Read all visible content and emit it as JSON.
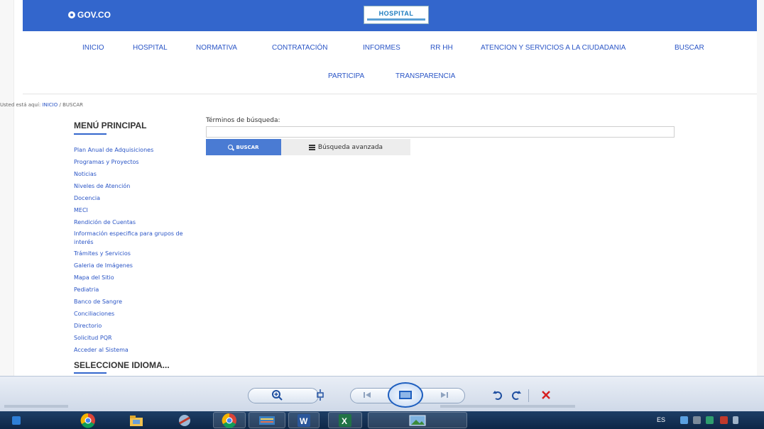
{
  "gov_bar": {
    "logo_text": "GOV.CO",
    "hospital_logo_text": "HOSPITAL"
  },
  "nav": {
    "row1": [
      "INICIO",
      "HOSPITAL",
      "NORMATIVA",
      "CONTRATACIÓN",
      "INFORMES",
      "RR HH",
      "ATENCION Y SERVICIOS A LA CIUDADANIA",
      "BUSCAR"
    ],
    "row2": [
      "PARTICIPA",
      "TRANSPARENCIA"
    ]
  },
  "breadcrumb": {
    "prefix": "Usted está aquí:",
    "home": "INICIO",
    "separator": "/",
    "current": "BUSCAR"
  },
  "sidebar": {
    "title": "MENÚ PRINCIPAL",
    "items": [
      "Plan Anual de Adquisiciones",
      "Programas y Proyectos",
      "Noticias",
      "Niveles de Atención",
      "Docencia",
      "MECI",
      "Rendición de Cuentas",
      "Información especifica para grupos de interés",
      "Trámites y Servicios",
      "Galeria de Imágenes",
      "Mapa del Sitio",
      "Pediatria",
      "Banco de Sangre",
      "Conciliaciones",
      "Directorio",
      "Solicitud PQR",
      "Acceder al Sistema"
    ],
    "language_title": "SELECCIONE IDIOMA..."
  },
  "search": {
    "label": "Términos de búsqueda:",
    "value": "",
    "search_button": "BUSCAR",
    "advanced_button": "Búsqueda avanzada"
  },
  "taskbar": {
    "language": "ES"
  },
  "icons": {
    "zoom": "zoom-in-icon",
    "fit": "fit-window-icon",
    "prev": "previous-icon",
    "slideshow": "slideshow-icon",
    "next": "next-icon",
    "rotate_ccw": "rotate-counterclockwise-icon",
    "rotate_cw": "rotate-clockwise-icon",
    "delete": "delete-icon"
  },
  "colors": {
    "gov_blue": "#3366cc",
    "link_blue": "#2a55c6",
    "button_blue": "#4a7bd3",
    "delete_red": "#d62020"
  }
}
